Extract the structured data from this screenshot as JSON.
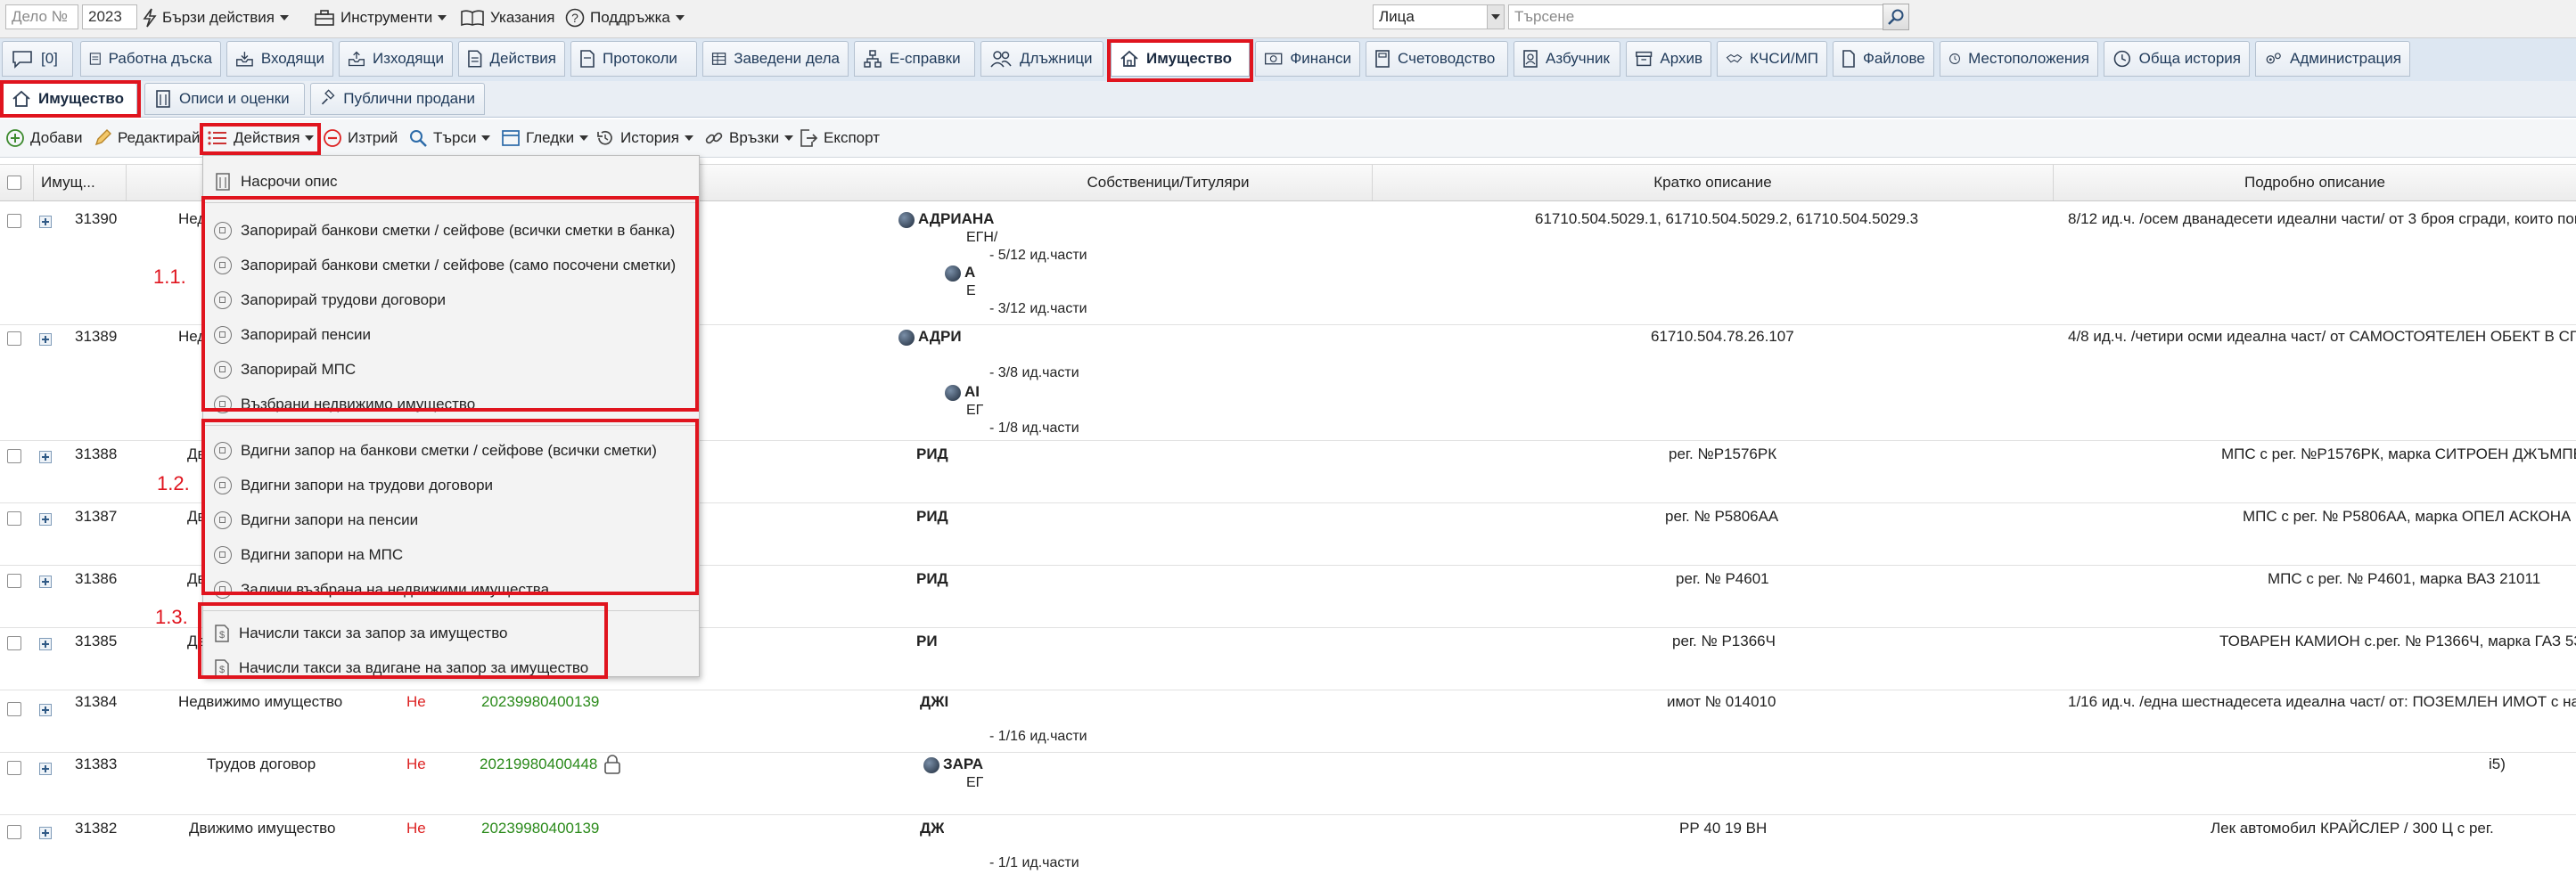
{
  "topbar": {
    "depot_placeholder": "Дело №",
    "year_value": "2023",
    "quick_actions": "Бързи действия",
    "tools": "Инструменти",
    "instructions": "Указания",
    "support": "Поддръжка",
    "search_scope": "Лица",
    "search_placeholder": "Търсене"
  },
  "tabs": [
    {
      "label": "[0]"
    },
    {
      "label": "Работна дъска"
    },
    {
      "label": "Входящи"
    },
    {
      "label": "Изходящи"
    },
    {
      "label": "Действия"
    },
    {
      "label": "Протоколи"
    },
    {
      "label": "Заведени дела"
    },
    {
      "label": "Е-справки"
    },
    {
      "label": "Длъжници"
    },
    {
      "label": "Имущество"
    },
    {
      "label": "Финанси"
    },
    {
      "label": "Счетоводство"
    },
    {
      "label": "Азбучник"
    },
    {
      "label": "Архив"
    },
    {
      "label": "КЧСИ/МП"
    },
    {
      "label": "Файлове"
    },
    {
      "label": "Местоположения"
    },
    {
      "label": "Обща история"
    },
    {
      "label": "Администрация"
    }
  ],
  "subtabs": [
    {
      "label": "Имущество"
    },
    {
      "label": "Описи и оценки"
    },
    {
      "label": "Публични продани"
    }
  ],
  "toolbar": {
    "add": "Добави",
    "edit": "Редактирай",
    "actions": "Действия",
    "delete": "Изтрий",
    "search": "Търси",
    "views": "Гледки",
    "history": "История",
    "links": "Връзки",
    "export": "Експорт"
  },
  "grid": {
    "headers": {
      "id": "Имущ...",
      "owners": "Собственици/Титуляри",
      "short": "Кратко описание",
      "detail": "Подробно описание"
    },
    "rows": [
      {
        "id": "31390",
        "type": "Нед",
        "owner1": "АДРИАНА",
        "owner1_sub": "ЕГН/",
        "share1": "- 5/12 ид.части",
        "owner2": "А",
        "owner2_sub": "Е",
        "share2": "- 3/12 ид.части",
        "short": "61710.504.5029.1, 61710.504.5029.2, 61710.504.5029.3",
        "detail": "8/12 ид.ч. /осем дванадесети идеални части/ от 3 броя сгради, които попа"
      },
      {
        "id": "31389",
        "type": "Нед",
        "owner1": "АДРИ",
        "share1": "- 3/8 ид.части",
        "owner2": "АI",
        "owner2_sub": "ЕГ",
        "share2": "- 1/8 ид.части",
        "short": "61710.504.78.26.107",
        "detail": "4/8 ид.ч. /четири осми идеална част/ от САМОСТОЯТЕЛЕН ОБЕКТ В СГРА"
      },
      {
        "id": "31388",
        "type": "Дв",
        "owner1": "РИД",
        "short": "рег. №Р1576РК",
        "detail": "МПС с рег. №Р1576РК, марка СИТРОЕН ДЖЪМПЕ"
      },
      {
        "id": "31387",
        "type": "Дв",
        "owner1": "РИД",
        "short": "рег. № Р5806АА",
        "detail": "МПС с рег. № Р5806АА, марка ОПЕЛ АСКОНА"
      },
      {
        "id": "31386",
        "type": "Дв",
        "owner1": "РИД",
        "short": "рег. № Р4601",
        "detail": "МПС с рег. № Р4601, марка ВАЗ 21011"
      },
      {
        "id": "31385",
        "type": "Дв",
        "owner1": "РИ",
        "short": "рег. № Р1366Ч",
        "detail": "ТОВАРЕН КАМИОН с.рег. № Р1366Ч, марка ГАЗ 53"
      },
      {
        "id": "31384",
        "type": "Недвижимо имущество",
        "flag": "Не",
        "case": "20239980400139",
        "owner1": "ДЖI",
        "share1": "- 1/16 ид.части",
        "short": "имот № 014010",
        "detail": "1/16 ид.ч. /една шестнадесета идеална част/ от: ПОЗЕМЛЕН ИМОТ с начи"
      },
      {
        "id": "31383",
        "type": "Трудов договор",
        "flag": "Не",
        "case": "20219980400448",
        "owner1": "ЗАРА",
        "owner1_sub": "ЕГ",
        "short": "",
        "detail": "i5)"
      },
      {
        "id": "31382",
        "type": "Движимо имущество",
        "flag": "Не",
        "case": "20239980400139",
        "owner1": "ДЖ",
        "share1": "- 1/1 ид.части",
        "short": "РР 40 19 ВН",
        "detail": "Лек автомобил КРАЙСЛЕР / 300 Ц с рег."
      }
    ]
  },
  "menu": {
    "top": "Насрочи опис",
    "group1": [
      "Запорирай банкови сметки / сейфове (всички сметки в банка)",
      "Запорирай банкови сметки / сейфове (само посочени сметки)",
      "Запорирай трудови договори",
      "Запорирай пенсии",
      "Запорирай МПС",
      "Възбрани недвижимо имущество"
    ],
    "group2": [
      "Вдигни запор на банкови сметки / сейфове (всички сметки)",
      "Вдигни запори на трудови договори",
      "Вдигни запори на пенсии",
      "Вдигни запори на МПС",
      "Заличи възбрана на недвижими имущества"
    ],
    "group3": [
      "Начисли такси за запор за имущество",
      "Начисли такси за вдигане на запор за имущество"
    ]
  },
  "annotations": {
    "a1": "1.1.",
    "a2": "1.2.",
    "a3": "1.3."
  },
  "colors": {
    "highlight": "#e0141e",
    "tab_bar": "#dde7f2",
    "case_green": "#2a8a1a",
    "flag_red": "#d22222"
  }
}
